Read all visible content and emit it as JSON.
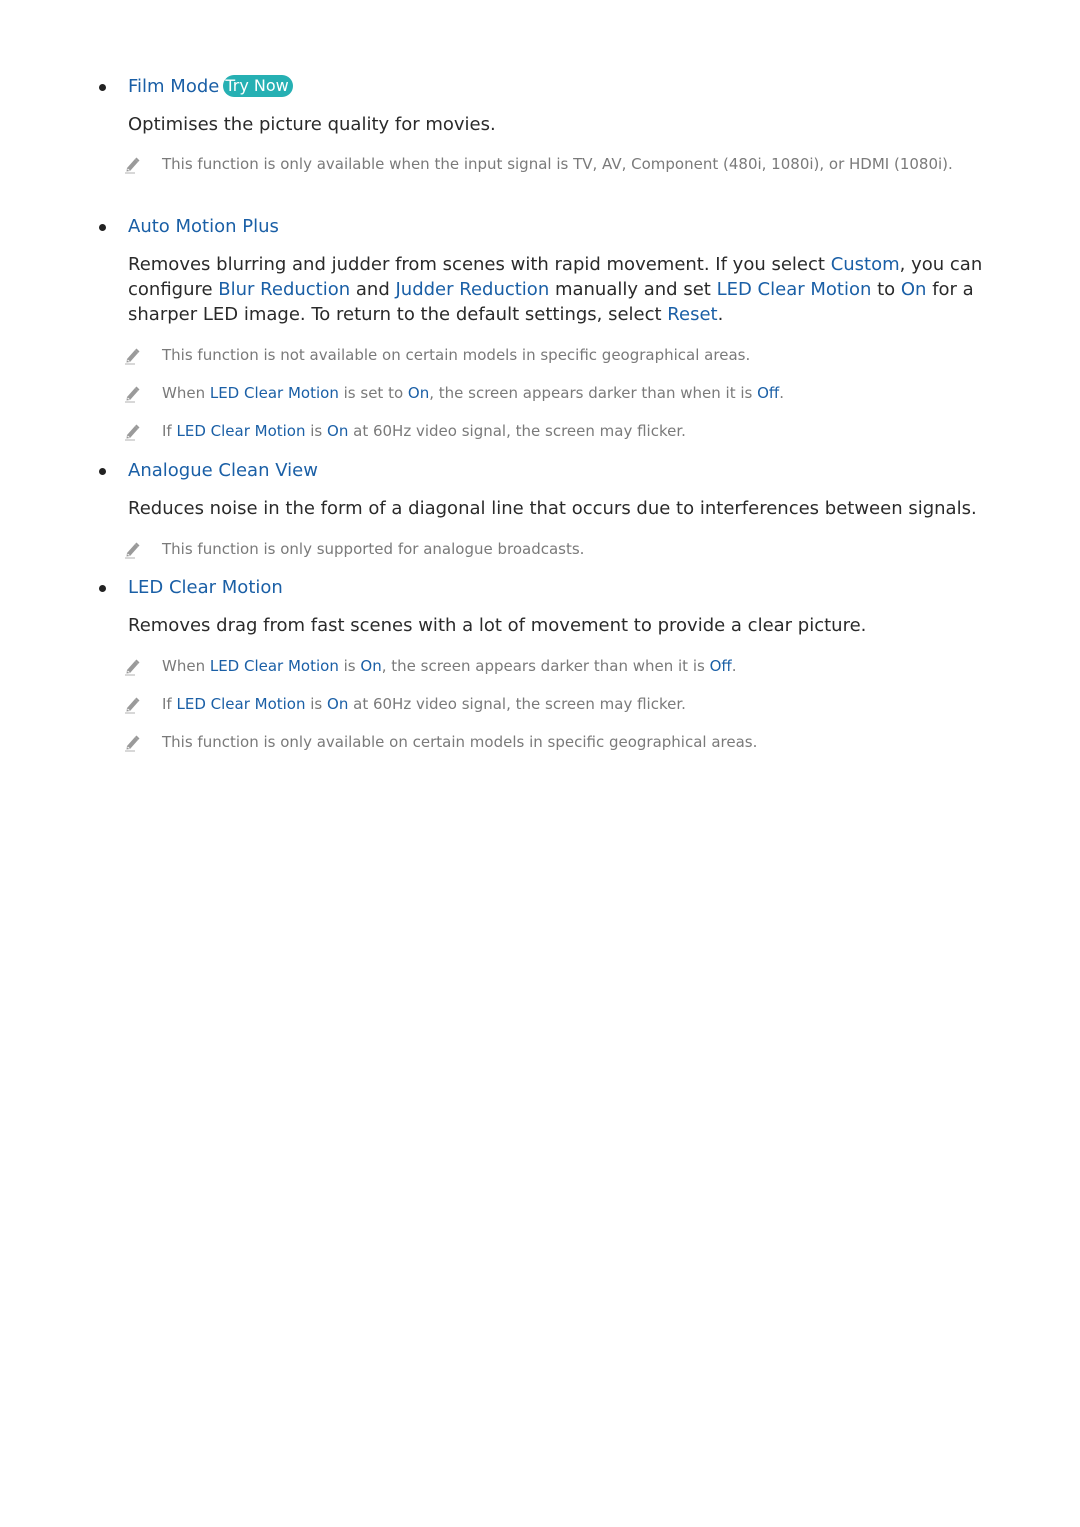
{
  "sections": [
    {
      "heading": "Film Mode",
      "badge": "Try Now",
      "description": [
        {
          "text": "Optimises the picture quality for movies.",
          "hl": false
        }
      ],
      "notes": [
        [
          {
            "text": "This function is only available when the input signal is TV, AV, Component (480i, 1080i), or HDMI (1080i).",
            "hl": false
          }
        ]
      ]
    },
    {
      "heading": "Auto Motion Plus",
      "description": [
        {
          "text": "Removes blurring and judder from scenes with rapid movement. If you select ",
          "hl": false
        },
        {
          "text": "Custom",
          "hl": true
        },
        {
          "text": ", you can configure ",
          "hl": false
        },
        {
          "text": "Blur Reduction",
          "hl": true
        },
        {
          "text": " and ",
          "hl": false
        },
        {
          "text": "Judder Reduction",
          "hl": true
        },
        {
          "text": " manually and set ",
          "hl": false
        },
        {
          "text": "LED Clear Motion",
          "hl": true
        },
        {
          "text": " to ",
          "hl": false
        },
        {
          "text": "On",
          "hl": true
        },
        {
          "text": " for a sharper LED image. To return to the default settings, select ",
          "hl": false
        },
        {
          "text": "Reset",
          "hl": true
        },
        {
          "text": ".",
          "hl": false
        }
      ],
      "notes": [
        [
          {
            "text": "This function is not available on certain models in specific geographical areas.",
            "hl": false
          }
        ],
        [
          {
            "text": "When ",
            "hl": false
          },
          {
            "text": "LED Clear Motion",
            "hl": true
          },
          {
            "text": " is set to ",
            "hl": false
          },
          {
            "text": "On",
            "hl": true
          },
          {
            "text": ", the screen appears darker than when it is ",
            "hl": false
          },
          {
            "text": "Off",
            "hl": true
          },
          {
            "text": ".",
            "hl": false
          }
        ],
        [
          {
            "text": "If ",
            "hl": false
          },
          {
            "text": "LED Clear Motion",
            "hl": true
          },
          {
            "text": " is ",
            "hl": false
          },
          {
            "text": "On",
            "hl": true
          },
          {
            "text": " at 60Hz video signal, the screen may flicker.",
            "hl": false
          }
        ]
      ]
    },
    {
      "heading": "Analogue Clean View",
      "description": [
        {
          "text": "Reduces noise in the form of a diagonal line that occurs due to interferences between signals.",
          "hl": false
        }
      ],
      "notes": [
        [
          {
            "text": "This function is only supported for analogue broadcasts.",
            "hl": false
          }
        ]
      ]
    },
    {
      "heading": "LED Clear Motion",
      "description": [
        {
          "text": "Removes drag from fast scenes with a lot of movement to provide a clear picture.",
          "hl": false
        }
      ],
      "notes": [
        [
          {
            "text": "When ",
            "hl": false
          },
          {
            "text": "LED Clear Motion",
            "hl": true
          },
          {
            "text": " is ",
            "hl": false
          },
          {
            "text": "On",
            "hl": true
          },
          {
            "text": ", the screen appears darker than when it is ",
            "hl": false
          },
          {
            "text": "Off",
            "hl": true
          },
          {
            "text": ".",
            "hl": false
          }
        ],
        [
          {
            "text": "If ",
            "hl": false
          },
          {
            "text": "LED Clear Motion",
            "hl": true
          },
          {
            "text": " is ",
            "hl": false
          },
          {
            "text": "On",
            "hl": true
          },
          {
            "text": " at 60Hz video signal, the screen may flicker.",
            "hl": false
          }
        ],
        [
          {
            "text": "This function is only available on certain models in specific geographical areas.",
            "hl": false
          }
        ]
      ]
    }
  ],
  "icons": {
    "note": "pencil-icon"
  },
  "colors": {
    "link": "#1a5fa6",
    "badge_bg": "#26b0b3",
    "body_text": "#2a2a2a",
    "note_text": "#7a7a7a"
  }
}
